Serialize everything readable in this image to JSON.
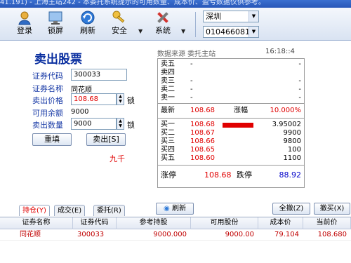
{
  "titlebar": {
    "text": "41.191)  - 上海主站242 - 本委托系统提示的可用数量、成本价、盈亏数据仅供参考。"
  },
  "toolbar": {
    "buttons": [
      {
        "label": "登录",
        "icon": "login-icon"
      },
      {
        "label": "锁屏",
        "icon": "lock-screen-icon"
      },
      {
        "label": "刷新",
        "icon": "refresh-icon"
      },
      {
        "label": "安全",
        "icon": "security-icon"
      },
      {
        "label": "系统",
        "icon": "system-tools-icon"
      }
    ],
    "market": "深圳",
    "account": "0104660812"
  },
  "sell_form": {
    "title": "卖出股票",
    "code_label": "证券代码",
    "code_value": "300033",
    "name_label": "证券名称",
    "name_value": "同花顺",
    "price_label": "卖出价格",
    "price_value": "108.68",
    "available_label": "可用余额",
    "available_value": "9000",
    "qty_label": "卖出数量",
    "qty_value": "9000",
    "lock_label": "锁",
    "reset_label": "重填",
    "sell_label": "卖出[S]",
    "hint": "九千"
  },
  "quote": {
    "source_label": "数据来源 委托主站",
    "time": "16:18::4",
    "asks": [
      {
        "label": "卖五",
        "price": "-",
        "vol": "-"
      },
      {
        "label": "卖四",
        "price": "",
        "vol": ""
      },
      {
        "label": "卖三",
        "price": "-",
        "vol": "-"
      },
      {
        "label": "卖二",
        "price": "-",
        "vol": "-"
      },
      {
        "label": "卖一",
        "price": "-",
        "vol": "-"
      }
    ],
    "last_label": "最新",
    "last_price": "108.68",
    "change_label": "涨幅",
    "change_value": "10.000%",
    "bids": [
      {
        "label": "买一",
        "price": "108.68",
        "vol": "3.95002",
        "bar": true
      },
      {
        "label": "买二",
        "price": "108.67",
        "vol": "9900"
      },
      {
        "label": "买三",
        "price": "108.66",
        "vol": "9800"
      },
      {
        "label": "买四",
        "price": "108.65",
        "vol": "100"
      },
      {
        "label": "买五",
        "price": "108.60",
        "vol": "1100"
      }
    ],
    "limit_up_label": "涨停",
    "limit_up": "108.68",
    "limit_down_label": "跌停",
    "limit_down": "88.92"
  },
  "tabs": {
    "items": [
      "持仓(Y)",
      "成交(E)",
      "委托(R)"
    ],
    "refresh_label": "刷新",
    "select_all_label": "全撤(Z)",
    "cancel_label": "撤买(X)"
  },
  "table": {
    "columns": [
      "证券名称",
      "证券代码",
      "参考持股",
      "可用股份",
      "成本价",
      "当前价"
    ],
    "rows": [
      [
        "同花顺",
        "300033",
        "9000.000",
        "9000.00",
        "79.104",
        "108.680"
      ]
    ]
  },
  "colors": {
    "accent_red": "#e00000",
    "label_blue": "#1739a6",
    "title_blue": "#0a2fa0"
  }
}
